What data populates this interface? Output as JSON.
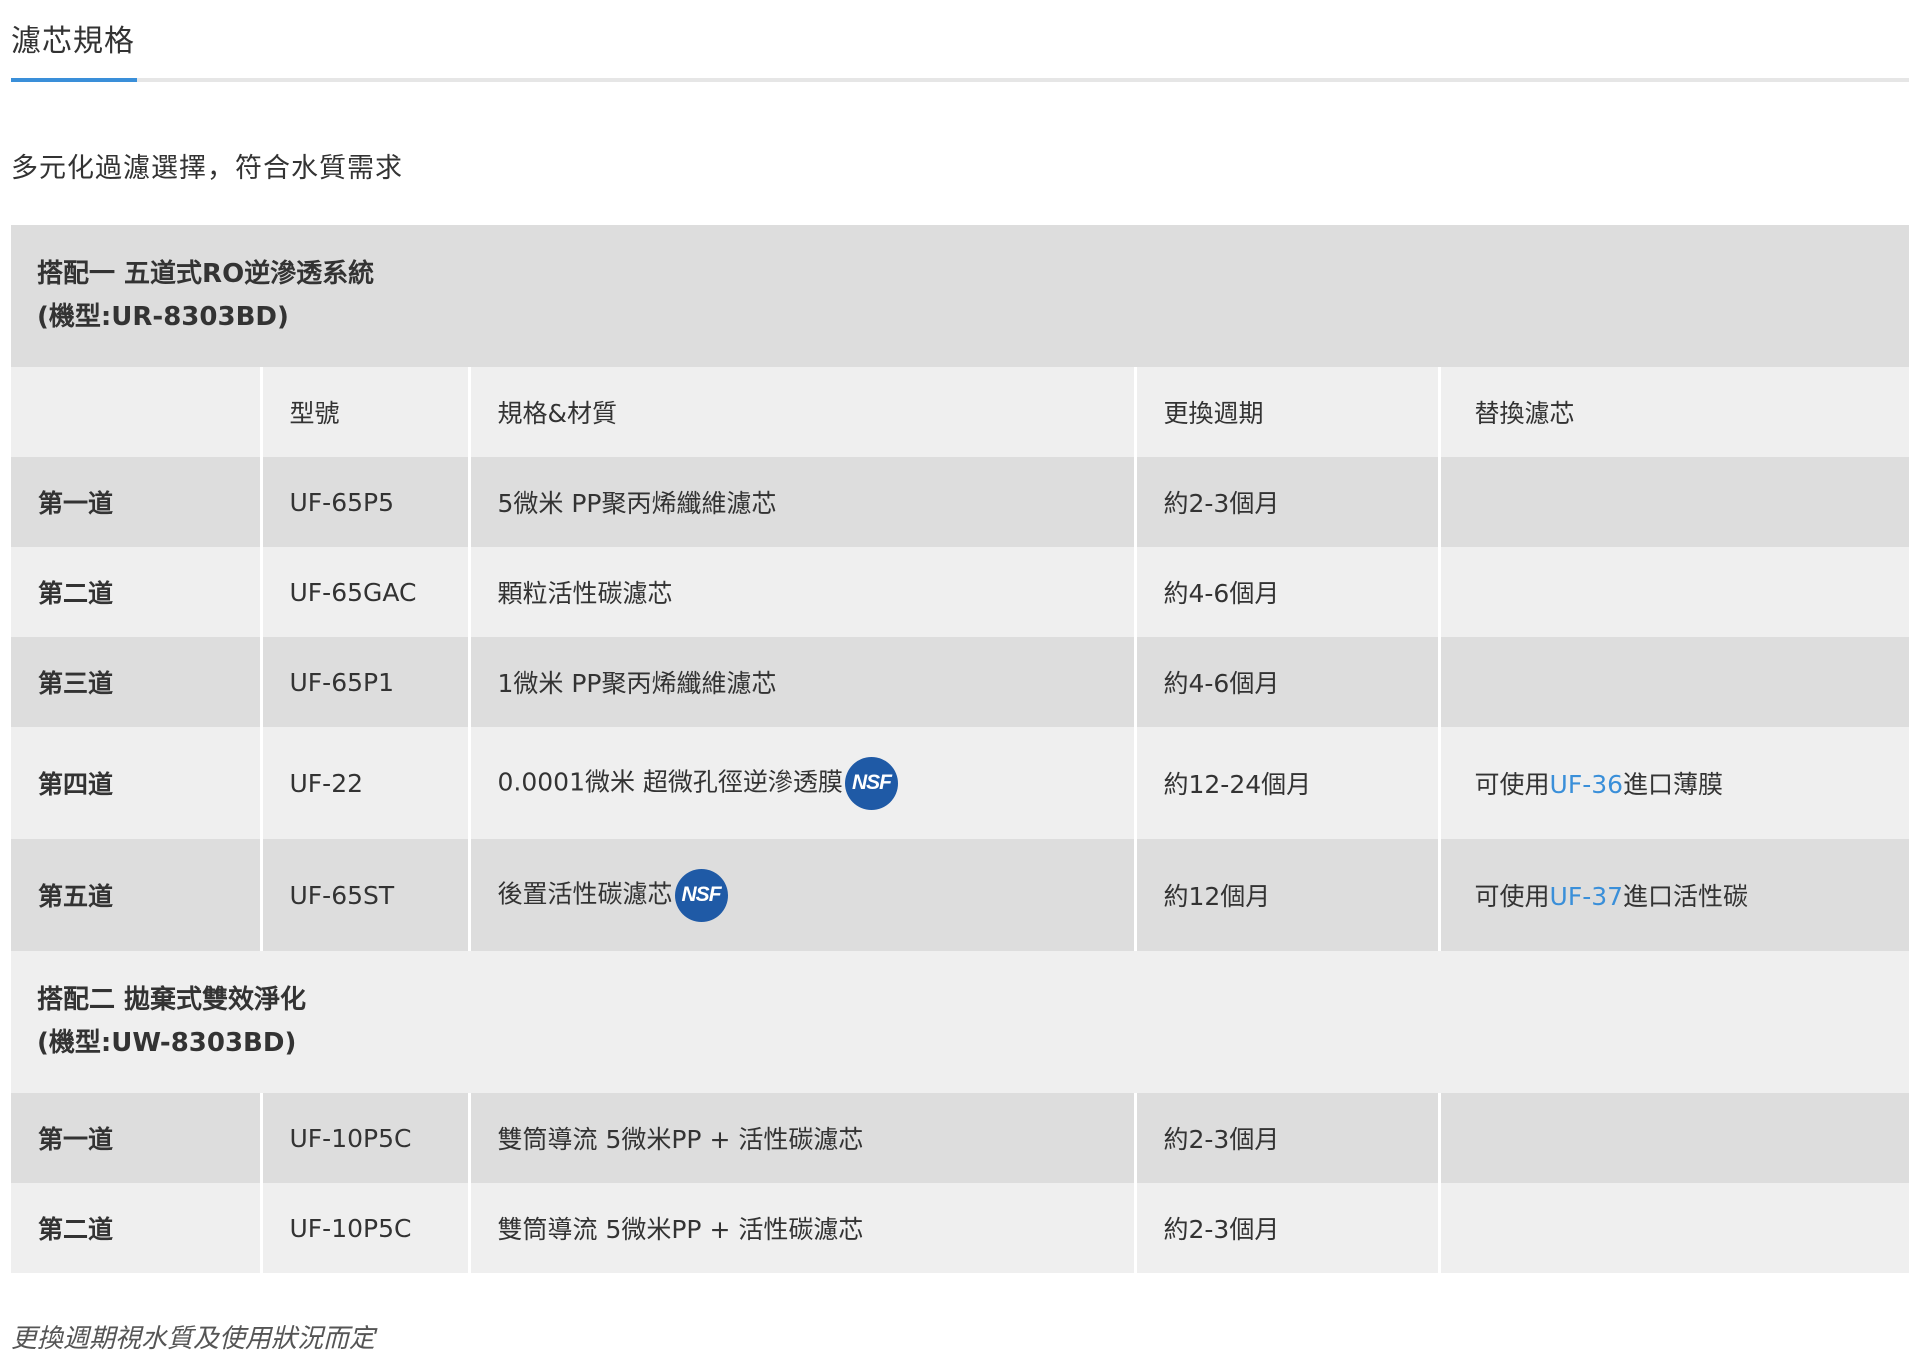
{
  "tab": {
    "title": "濾芯規格"
  },
  "subtitle": "多元化過濾選擇，符合水質需求",
  "sections": [
    {
      "title": "搭配一 五道式RO逆滲透系統",
      "model": "(機型:UR-8303BD)"
    },
    {
      "title": "搭配二  拋棄式雙效淨化",
      "model": "(機型:UW-8303BD)"
    }
  ],
  "columns": [
    "",
    "型號",
    "規格&材質",
    "更換週期",
    "替換濾芯"
  ],
  "system1_rows": [
    {
      "stage": "第一道",
      "model": "UF-65P5",
      "spec": "5微米 PP聚丙烯纖維濾芯",
      "cycle": "約2-3個月"
    },
    {
      "stage": "第二道",
      "model": "UF-65GAC",
      "spec": "顆粒活性碳濾芯",
      "cycle": "約4-6個月"
    },
    {
      "stage": "第三道",
      "model": "UF-65P1",
      "spec": "1微米 PP聚丙烯纖維濾芯",
      "cycle": "約4-6個月"
    },
    {
      "stage": "第四道",
      "model": "UF-22",
      "spec": "0.0001微米 超微孔徑逆滲透膜",
      "badge": "NSF",
      "cycle": "約12-24個月",
      "replace_prefix": "可使用",
      "replace_link": "UF-36",
      "replace_suffix": "進口薄膜"
    },
    {
      "stage": "第五道",
      "model": "UF-65ST",
      "spec": "後置活性碳濾芯",
      "badge": "NSF",
      "cycle": "約12個月",
      "replace_prefix": "可使用",
      "replace_link": "UF-37",
      "replace_suffix": "進口活性碳"
    }
  ],
  "system2_rows": [
    {
      "stage": "第一道",
      "model": "UF-10P5C",
      "spec": "雙筒導流 5微米PP + 活性碳濾芯",
      "cycle": "約2-3個月"
    },
    {
      "stage": "第二道",
      "model": "UF-10P5C",
      "spec": "雙筒導流 5微米PP + 活性碳濾芯",
      "cycle": "約2-3個月"
    }
  ],
  "footnote": "更換週期視水質及使用狀況而定",
  "colors": {
    "accent": "#3a8fd9",
    "row_dark": "#dddddd",
    "row_light": "#efefef",
    "nsf_badge": "#1f5aa6"
  }
}
